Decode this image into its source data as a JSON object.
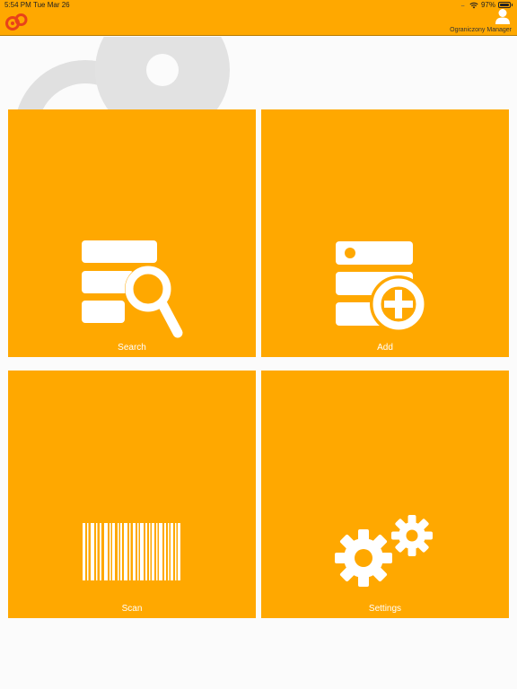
{
  "status_bar": {
    "time": "5:54 PM",
    "date": "Tue Mar 26",
    "signal": "....",
    "battery": "97%"
  },
  "header": {
    "logo": "brand-logo-icon",
    "user_icon": "user-icon",
    "user_name": "Ograniczony Manager"
  },
  "tiles": [
    {
      "label": "Search",
      "icon": "search-database-icon"
    },
    {
      "label": "Add",
      "icon": "add-database-icon"
    },
    {
      "label": "Scan",
      "icon": "barcode-icon"
    },
    {
      "label": "Settings",
      "icon": "gears-icon"
    }
  ],
  "colors": {
    "accent": "#ffa800",
    "tile_foreground": "#ffffff",
    "logo": "#e8421a",
    "background": "#fbfbfb"
  }
}
